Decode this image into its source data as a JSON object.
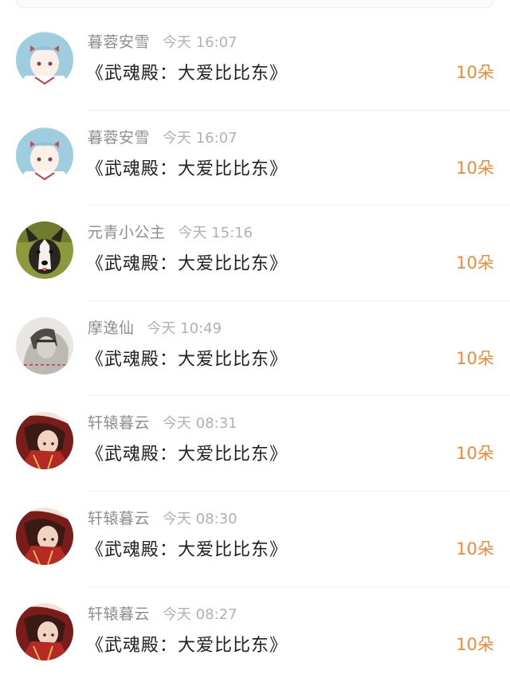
{
  "colors": {
    "accent": "#ef8a34",
    "username": "#8e8e8e",
    "time": "#b1b1b1",
    "text": "#222222"
  },
  "gifts": [
    {
      "avatar": "anime-girl-avatar",
      "username": "暮蓉安雪",
      "time": "今天 16:07",
      "message": "《武魂殿：大爱比比东》",
      "count": "10朵"
    },
    {
      "avatar": "anime-girl-avatar",
      "username": "暮蓉安雪",
      "time": "今天 16:07",
      "message": "《武魂殿：大爱比比东》",
      "count": "10朵"
    },
    {
      "avatar": "dog-avatar",
      "username": "元青小公主",
      "time": "今天 15:16",
      "message": "《武魂殿：大爱比比东》",
      "count": "10朵"
    },
    {
      "avatar": "gray-figure-avatar",
      "username": "摩逸仙",
      "time": "今天 10:49",
      "message": "《武魂殿：大爱比比东》",
      "count": "10朵"
    },
    {
      "avatar": "red-character-avatar",
      "username": "轩辕暮云",
      "time": "今天 08:31",
      "message": "《武魂殿：大爱比比东》",
      "count": "10朵"
    },
    {
      "avatar": "red-character-avatar",
      "username": "轩辕暮云",
      "time": "今天 08:30",
      "message": "《武魂殿：大爱比比东》",
      "count": "10朵"
    },
    {
      "avatar": "red-character-avatar",
      "username": "轩辕暮云",
      "time": "今天 08:27",
      "message": "《武魂殿：大爱比比东》",
      "count": "10朵"
    }
  ]
}
